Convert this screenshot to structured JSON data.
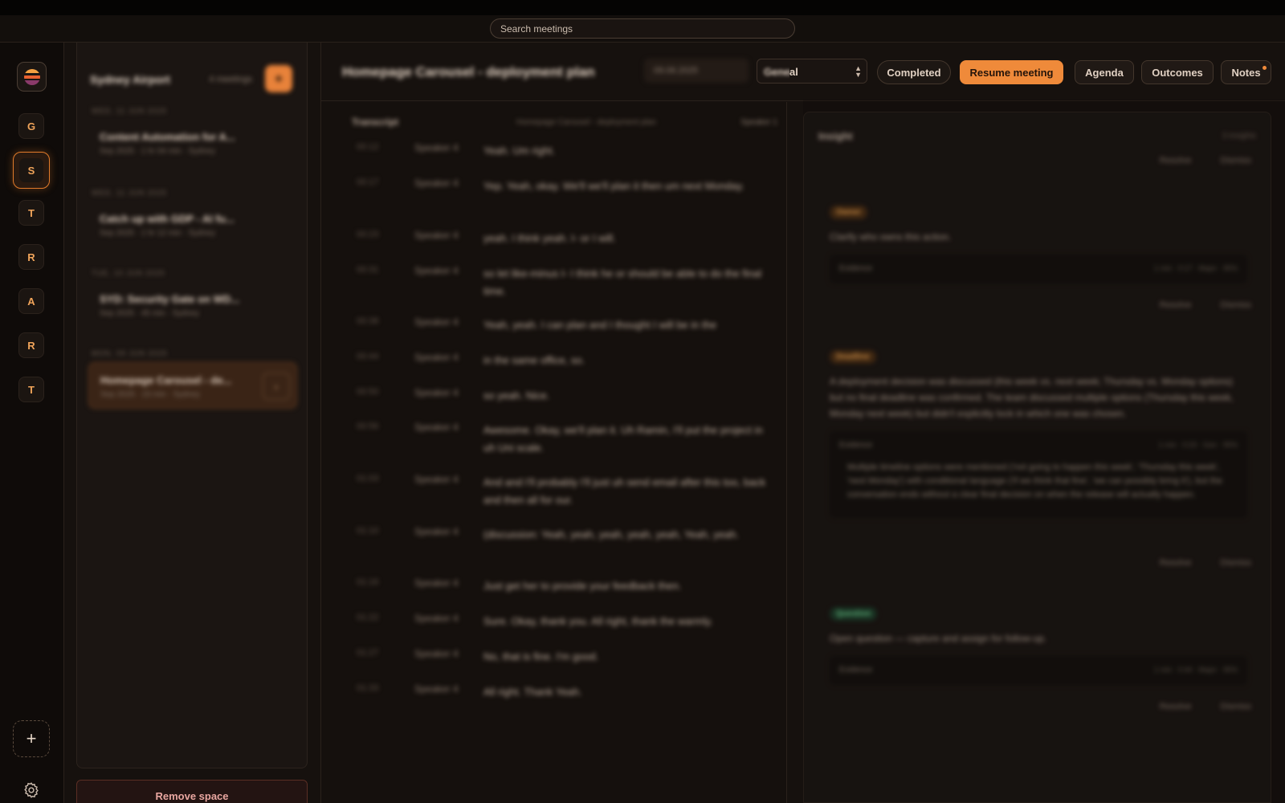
{
  "search": {
    "placeholder": "Search meetings"
  },
  "rail": {
    "items": [
      {
        "label": "G",
        "active": false
      },
      {
        "label": "S",
        "active": true
      },
      {
        "label": "T",
        "active": false
      },
      {
        "label": "R",
        "active": false
      },
      {
        "label": "A",
        "active": false
      },
      {
        "label": "R",
        "active": false
      },
      {
        "label": "T",
        "active": false
      }
    ],
    "add_label": "+"
  },
  "sidebar": {
    "title": "Sydney Airport",
    "count": "4 meetings",
    "new_label": "+",
    "groups": [
      {
        "date": "Wed, 11 Jun 2025",
        "title": "Content Automation for A...",
        "meta": "Sep 2025 · 1 hr 04 min · Sydney"
      },
      {
        "date": "Wed, 11 Jun 2025",
        "title": "Catch up with GDP - AI fu...",
        "meta": "Sep 2025 · 1 hr 12 min · Sydney"
      },
      {
        "date": "Tue, 10 Jun 2025",
        "title": "SYD: Security Gate on WD...",
        "meta": "Sep 2025 · 45 min · Sydney"
      },
      {
        "date": "Mon, 09 Jun 2025",
        "title": "Homepage Carousel - de...",
        "meta": "Sep 2025 · 23 min · Sydney"
      }
    ],
    "remove_label": "Remove space"
  },
  "header": {
    "title": "Homepage Carousel - deployment plan",
    "date": "09.06.2025",
    "space_value_blurred": "Gener",
    "space_value": "al",
    "status": "Completed",
    "resume": "Resume meeting",
    "tabs": [
      "Agenda",
      "Outcomes",
      "Notes"
    ]
  },
  "transcript": {
    "title": "Transcript",
    "subtitle": "Homepage Carousel - deployment plan",
    "speaker_filter": "Speaker 1",
    "rows": [
      {
        "time": "00:12",
        "speaker": "Speaker 4",
        "text": "Yeah. Um right."
      },
      {
        "time": "00:17",
        "speaker": "Speaker 4",
        "text": "Yep. Yeah, okay. We'll we'll plan it then um next Monday."
      },
      {
        "time": "00:23",
        "speaker": "Speaker 4",
        "text": "yeah. I think yeah. I- or I will."
      },
      {
        "time": "00:31",
        "speaker": "Speaker 4",
        "text": "so let like-minus I- I think he or should be able to do the final time."
      },
      {
        "time": "00:38",
        "speaker": "Speaker 4",
        "text": "Yeah, yeah. I can plan and I thought I will be in the"
      },
      {
        "time": "00:44",
        "speaker": "Speaker 4",
        "text": "in the same office, so."
      },
      {
        "time": "00:50",
        "speaker": "Speaker 4",
        "text": "so yeah. Nice."
      },
      {
        "time": "00:56",
        "speaker": "Speaker 4",
        "text": "Awesome. Okay, we'll plan it. Uh Ramin, I'll put the project in uh Uni scale."
      },
      {
        "time": "01:03",
        "speaker": "Speaker 4",
        "text": "And and I'll probably I'll just uh send email after this too, back and then all for our."
      },
      {
        "time": "01:10",
        "speaker": "Speaker 4",
        "text": "(discussion: Yeah, yeah, yeah, yeah, yeah, Yeah, yeah."
      },
      {
        "time": "01:16",
        "speaker": "Speaker 4",
        "text": "Just get her to provide your feedback then."
      },
      {
        "time": "01:22",
        "speaker": "Speaker 4",
        "text": "Sure. Okay, thank you. All right, thank the warmly."
      },
      {
        "time": "01:27",
        "speaker": "Speaker 4",
        "text": "No, that is fine. I'm good."
      },
      {
        "time": "01:33",
        "speaker": "Speaker 4",
        "text": "All right. Thank Yeah."
      }
    ]
  },
  "insights": {
    "title": "Insight",
    "count": "3 insights",
    "actions": [
      "Resolve",
      "Dismiss"
    ],
    "cards": [
      {
        "pill": "Owner",
        "tone": "orange",
        "text": "Clarify who owns this action.",
        "evidence_label": "Evidence",
        "evidence_meta": "1 min · 0:17 · Major · 95%",
        "quote": ""
      },
      {
        "pill": "Deadline",
        "tone": "orange",
        "text": "A deployment decision was discussed (this week vs. next week; Thursday vs. Monday options) but no final deadline was confirmed. The team discussed multiple options (Thursday this week, Monday next week) but didn't explicitly lock in which one was chosen.",
        "evidence_label": "Evidence",
        "evidence_meta": "1 min · 0:23 · Gen · 95%",
        "quote": "Multiple timeline options were mentioned ('not going to happen this week', 'Thursday this week', 'next Monday') with conditional language ('if we think that fine', 'we can possibly bring it'), but the conversation ends without a clear final decision on when the release will actually happen."
      },
      {
        "pill": "Question",
        "tone": "green",
        "text": "Open question — capture and assign for follow-up.",
        "evidence_label": "Evidence",
        "evidence_meta": "1 min · 0:44 · Major · 95%",
        "quote": ""
      }
    ]
  },
  "colors": {
    "accent": "#ef8a3a",
    "danger_text": "#e8a6a0",
    "success": "#6fd08f"
  }
}
